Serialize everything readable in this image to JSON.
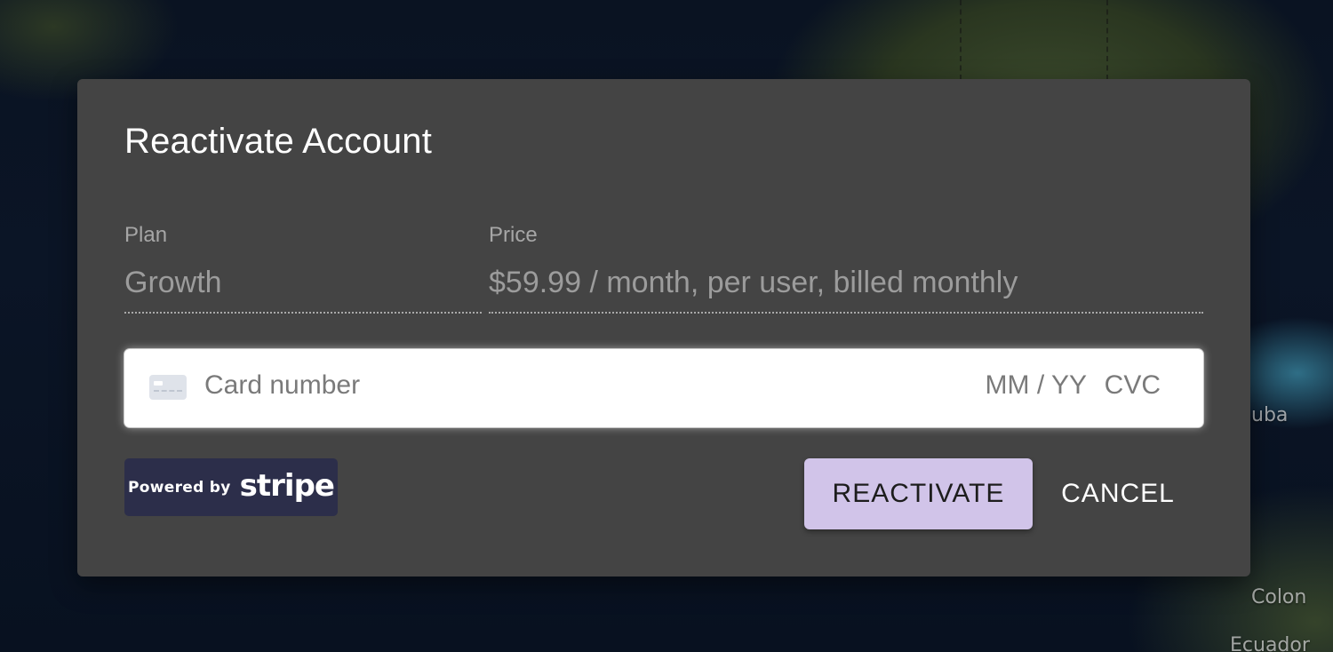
{
  "background": {
    "map_labels": [
      "uba",
      "Colon",
      "Ecuador"
    ]
  },
  "dialog": {
    "title": "Reactivate Account",
    "plan": {
      "label": "Plan",
      "value": "Growth"
    },
    "price": {
      "label": "Price",
      "value": "$59.99 / month, per user, billed monthly"
    },
    "card_input": {
      "icon": "credit-card-icon",
      "placeholder": "Card number",
      "expiry_placeholder": "MM / YY",
      "cvc_placeholder": "CVC"
    },
    "stripe_badge": {
      "powered_by": "Powered by",
      "brand": "stripe"
    },
    "actions": {
      "reactivate_label": "REACTIVATE",
      "cancel_label": "CANCEL"
    }
  },
  "colors": {
    "dialog_bg": "#444444",
    "primary_button": "#d1c4e9",
    "stripe_badge_bg": "#2c2e4a"
  }
}
